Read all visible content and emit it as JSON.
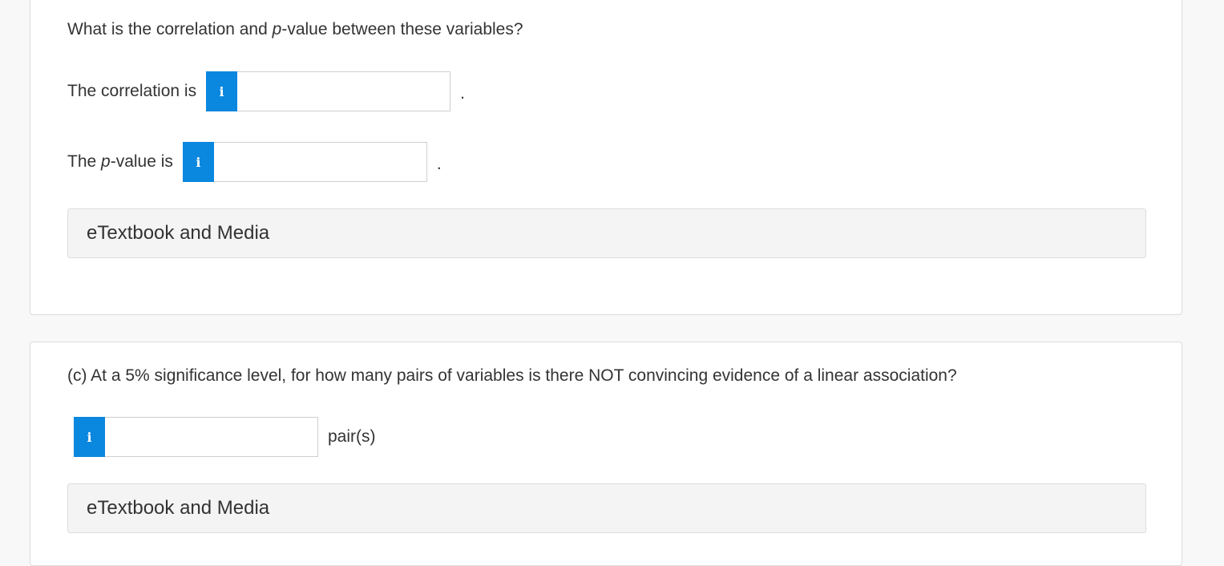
{
  "part_b": {
    "question_prefix": "What is the correlation and ",
    "question_italic": "p",
    "question_suffix": "-value between these variables?",
    "correlation_label": "The correlation is",
    "correlation_value": "",
    "pvalue_label_prefix": "The ",
    "pvalue_label_italic": "p",
    "pvalue_label_suffix": "-value is",
    "pvalue_value": "",
    "trailing_period": ".",
    "media_label": "eTextbook and Media"
  },
  "part_c": {
    "question": "(c) At a 5% significance level, for how many pairs of variables is there NOT convincing evidence of a linear association?",
    "answer_value": "",
    "unit_label": "pair(s)",
    "media_label": "eTextbook and Media"
  },
  "icons": {
    "info_glyph": "i"
  },
  "colors": {
    "info_button": "#0a87de",
    "media_bar": "#f4f4f4",
    "text": "#333333"
  }
}
